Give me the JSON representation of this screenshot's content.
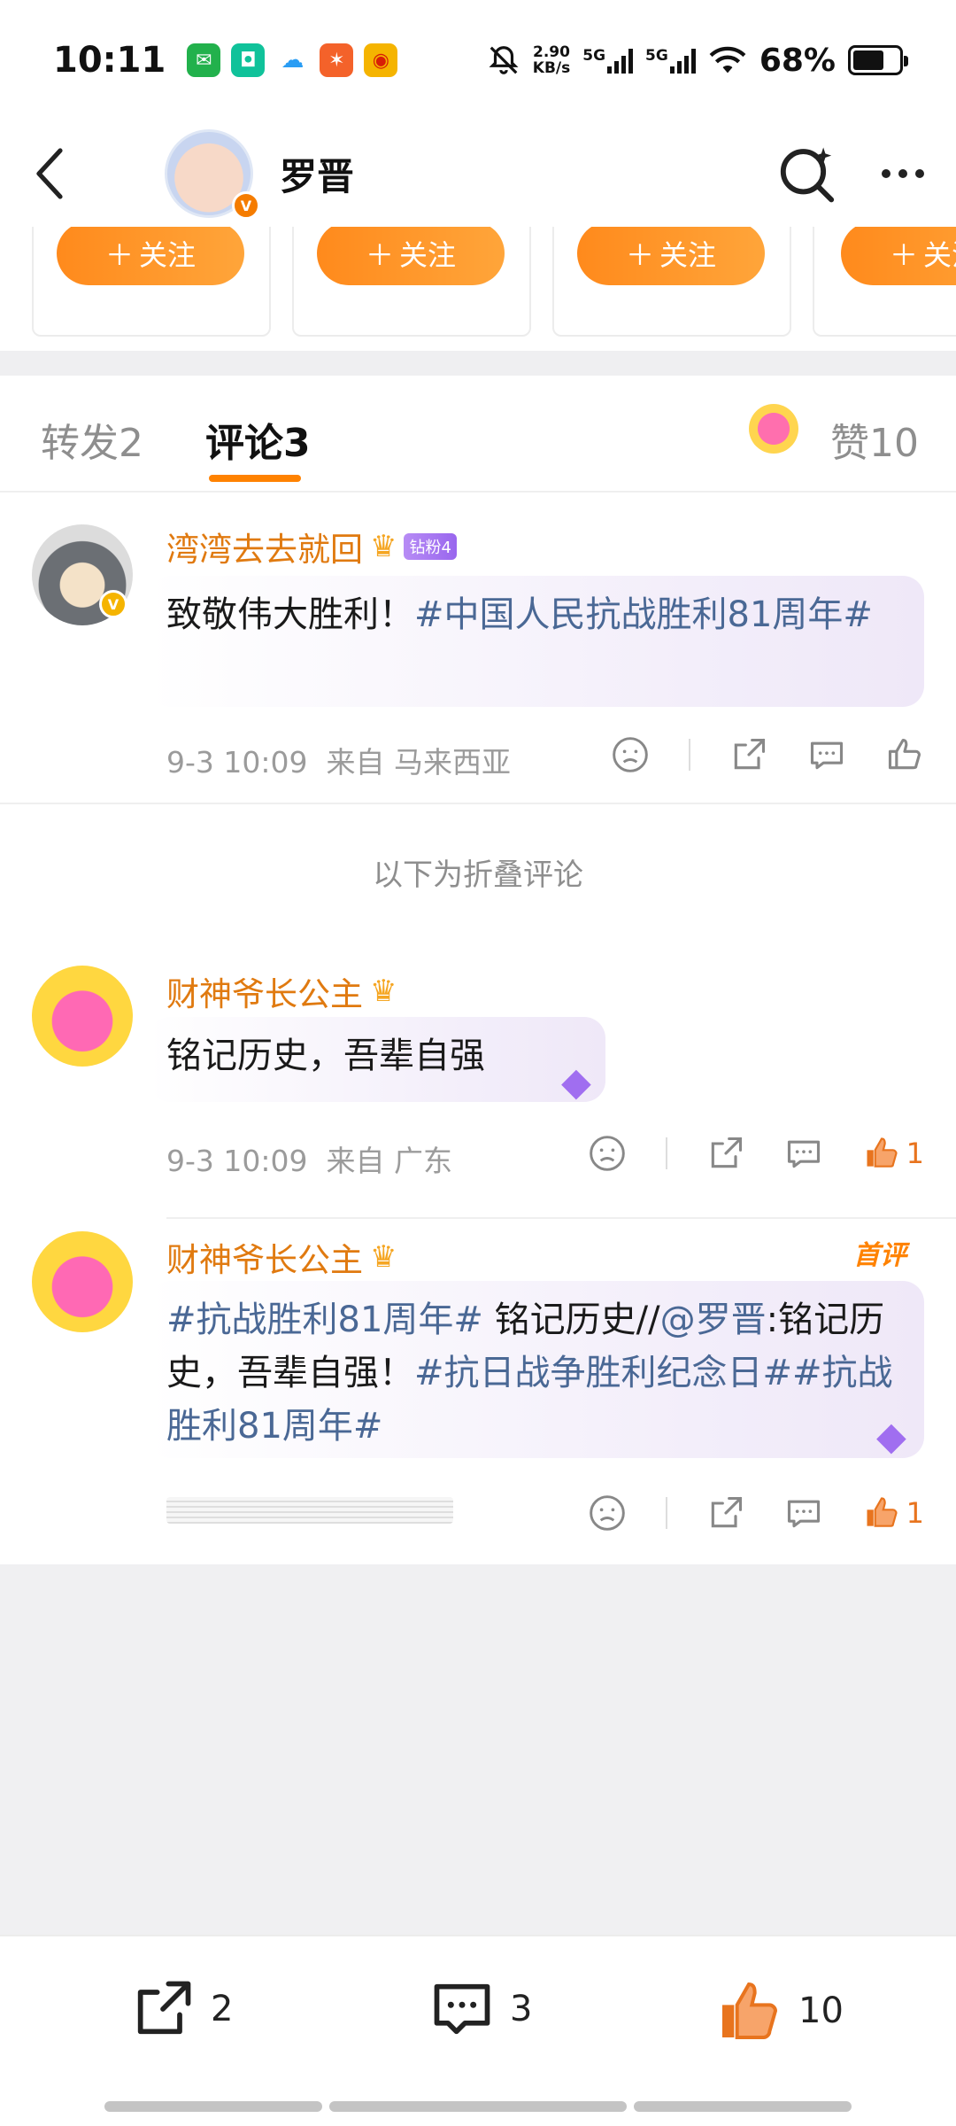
{
  "status_bar": {
    "time": "10:11",
    "net_speed_value": "2.90",
    "net_speed_unit": "KB/s",
    "signal_1": "5G",
    "signal_2": "5G",
    "battery": "68%",
    "battery_level_fraction": 0.68
  },
  "nav": {
    "title": "罗晋",
    "icons": [
      "back-icon",
      "verified-v-icon",
      "super-search-icon",
      "more-icon"
    ]
  },
  "follow_strip": {
    "button_label": "关注",
    "button_plus": "＋",
    "cards": 4
  },
  "tabs": {
    "repost_label": "转发",
    "repost_count": "2",
    "comment_label": "评论",
    "comment_count": "3",
    "like_label": "赞",
    "like_count": "10"
  },
  "comments": [
    {
      "username": "湾湾去去就回",
      "fan_badge": "钻粉4",
      "text_plain": "致敬伟大胜利！",
      "text_tag": "#中国人民抗战胜利81周年#",
      "time": "9-3 10:09",
      "from_label": "来自",
      "location": "马来西亚",
      "likes": ""
    }
  ],
  "folded_label": "以下为折叠评论",
  "folded_comments": [
    {
      "username": "财神爷长公主",
      "text": "铭记历史，吾辈自强",
      "time": "9-3 10:09",
      "from_label": "来自",
      "location": "广东",
      "likes": "1"
    },
    {
      "username": "财神爷长公主",
      "first_badge": "首评",
      "tag1": "#抗战胜利81周年#",
      "text1": " 铭记历史//",
      "mention": "@罗晋",
      "text2": ":铭记历史，吾辈自强！",
      "tag2": "#抗日战争胜利纪念日#",
      "tag3": "#抗战胜利81周年#",
      "likes": "1"
    }
  ],
  "bottom_bar": {
    "repost_count": "2",
    "comment_count": "3",
    "like_count": "10"
  },
  "colors": {
    "accent_orange": "#ff8200",
    "username_orange": "#e07a10",
    "topic_blue": "#4a6895",
    "meta_gray": "#9b9b9b"
  }
}
